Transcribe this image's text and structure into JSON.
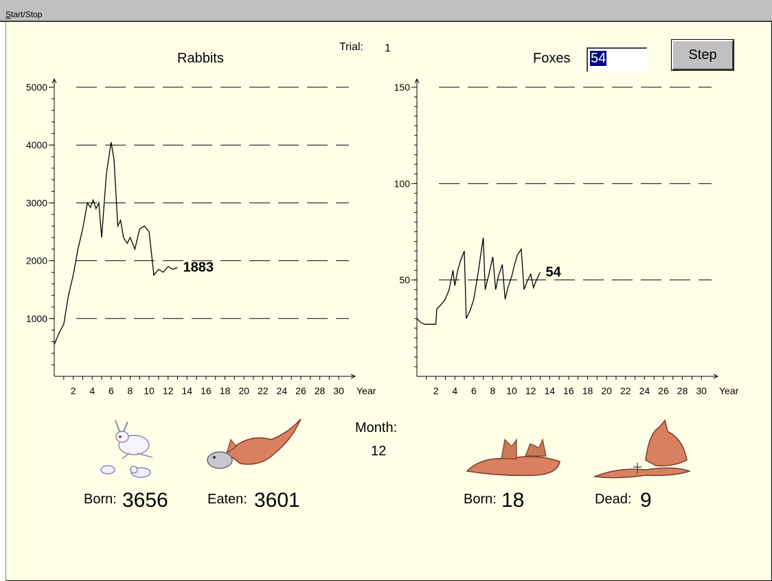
{
  "menu": {
    "start_stop_label": "Start/Stop",
    "start_stop_mnemonic": "S",
    "start_stop_rest": "tart/Stop"
  },
  "header": {
    "trial_label": "Trial:",
    "trial_value": "1",
    "rabbits_title": "Rabbits",
    "foxes_label": "Foxes",
    "foxes_input_value": "54",
    "step_button": "Step"
  },
  "month": {
    "label": "Month:",
    "value": "12"
  },
  "stats": {
    "rabbits_born_label": "Born:",
    "rabbits_born_value": "3656",
    "eaten_label": "Eaten:",
    "eaten_value": "3601",
    "foxes_born_label": "Born:",
    "foxes_born_value": "18",
    "dead_label": "Dead:",
    "dead_value": "9"
  },
  "chart_data": [
    {
      "type": "line",
      "title": "Rabbits",
      "xlabel": "Year",
      "xlim": [
        0,
        31
      ],
      "ylim": [
        0,
        5000
      ],
      "x_ticks": [
        2,
        4,
        6,
        8,
        10,
        12,
        14,
        16,
        18,
        20,
        22,
        24,
        26,
        28,
        30
      ],
      "y_ticks": [
        1000,
        2000,
        3000,
        4000,
        5000
      ],
      "grid": "dashed horizontal",
      "end_label": "1883",
      "series": [
        {
          "x": [
            0,
            0.5,
            1,
            1.5,
            2,
            2.5,
            3,
            3.5,
            3.8,
            4.1,
            4.4,
            4.7,
            5,
            5.5,
            6,
            6.3,
            6.7,
            7,
            7.3,
            7.7,
            8,
            8.5,
            9,
            9.5,
            10,
            10.5,
            11,
            11.5,
            12,
            12.5,
            13
          ],
          "y": [
            550,
            750,
            900,
            1400,
            1750,
            2200,
            2550,
            3000,
            2920,
            3050,
            2900,
            3000,
            2400,
            3500,
            4050,
            3750,
            2600,
            2700,
            2400,
            2300,
            2400,
            2200,
            2550,
            2600,
            2500,
            1750,
            1850,
            1800,
            1900,
            1850,
            1883
          ]
        }
      ]
    },
    {
      "type": "line",
      "title": "Foxes",
      "xlabel": "Year",
      "xlim": [
        0,
        31
      ],
      "ylim": [
        0,
        150
      ],
      "x_ticks": [
        2,
        4,
        6,
        8,
        10,
        12,
        14,
        16,
        18,
        20,
        22,
        24,
        26,
        28,
        30
      ],
      "y_ticks": [
        50,
        100,
        150
      ],
      "grid": "dashed horizontal",
      "end_label": "54",
      "series": [
        {
          "x": [
            0,
            0.4,
            0.8,
            1.2,
            1.5,
            2,
            2.1,
            2.5,
            3,
            3.4,
            3.8,
            4,
            4.3,
            4.6,
            5,
            5.2,
            5.6,
            6,
            6.5,
            7,
            7.2,
            7.6,
            8,
            8.3,
            8.6,
            9,
            9.3,
            9.6,
            10,
            10.3,
            10.6,
            11,
            11.3,
            11.6,
            12,
            12.3,
            12.6,
            13
          ],
          "y": [
            30,
            28,
            27,
            27,
            27,
            27,
            35,
            37,
            40,
            45,
            55,
            47,
            55,
            60,
            65,
            30,
            34,
            40,
            55,
            72,
            45,
            53,
            62,
            45,
            52,
            58,
            40,
            46,
            52,
            58,
            63,
            66,
            45,
            49,
            53,
            46,
            50,
            54
          ]
        }
      ]
    }
  ]
}
